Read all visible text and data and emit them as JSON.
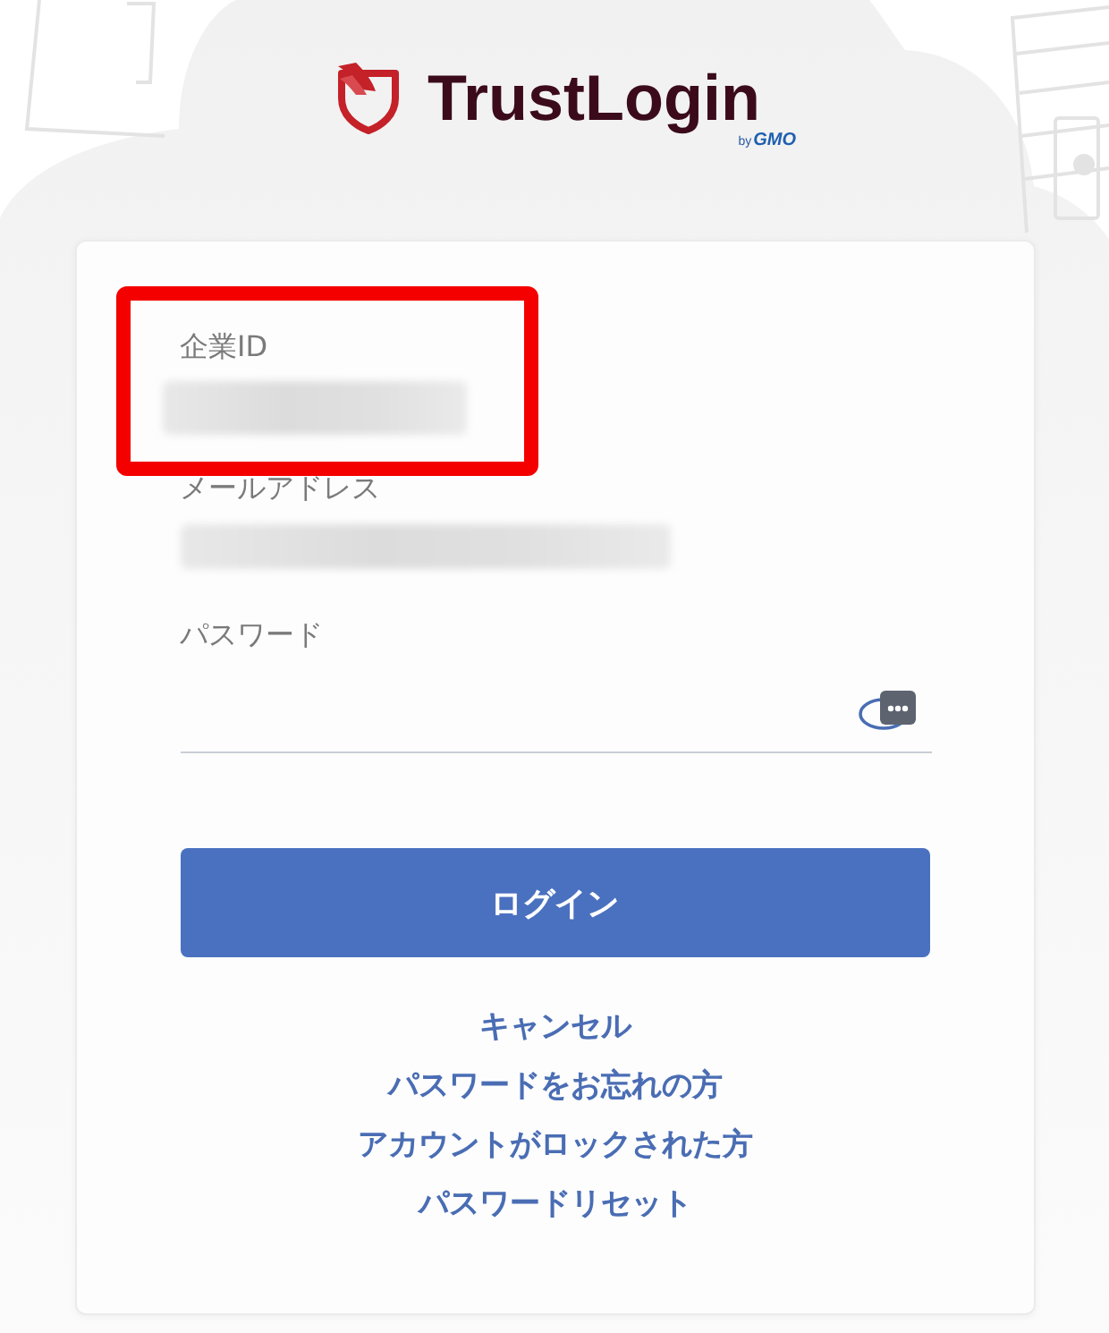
{
  "logo": {
    "name": "TrustLogin",
    "by": "by",
    "company": "GMO"
  },
  "form": {
    "fields": [
      {
        "kind": "text",
        "label": "企業ID",
        "highlighted": true
      },
      {
        "kind": "text",
        "label": "メールアドレス",
        "highlighted": false
      },
      {
        "kind": "password",
        "label": "パスワード",
        "highlighted": false
      }
    ],
    "submit": "ログイン",
    "links": [
      "キャンセル",
      "パスワードをお忘れの方",
      "アカウントがロックされた方",
      "パスワードリセット"
    ]
  }
}
